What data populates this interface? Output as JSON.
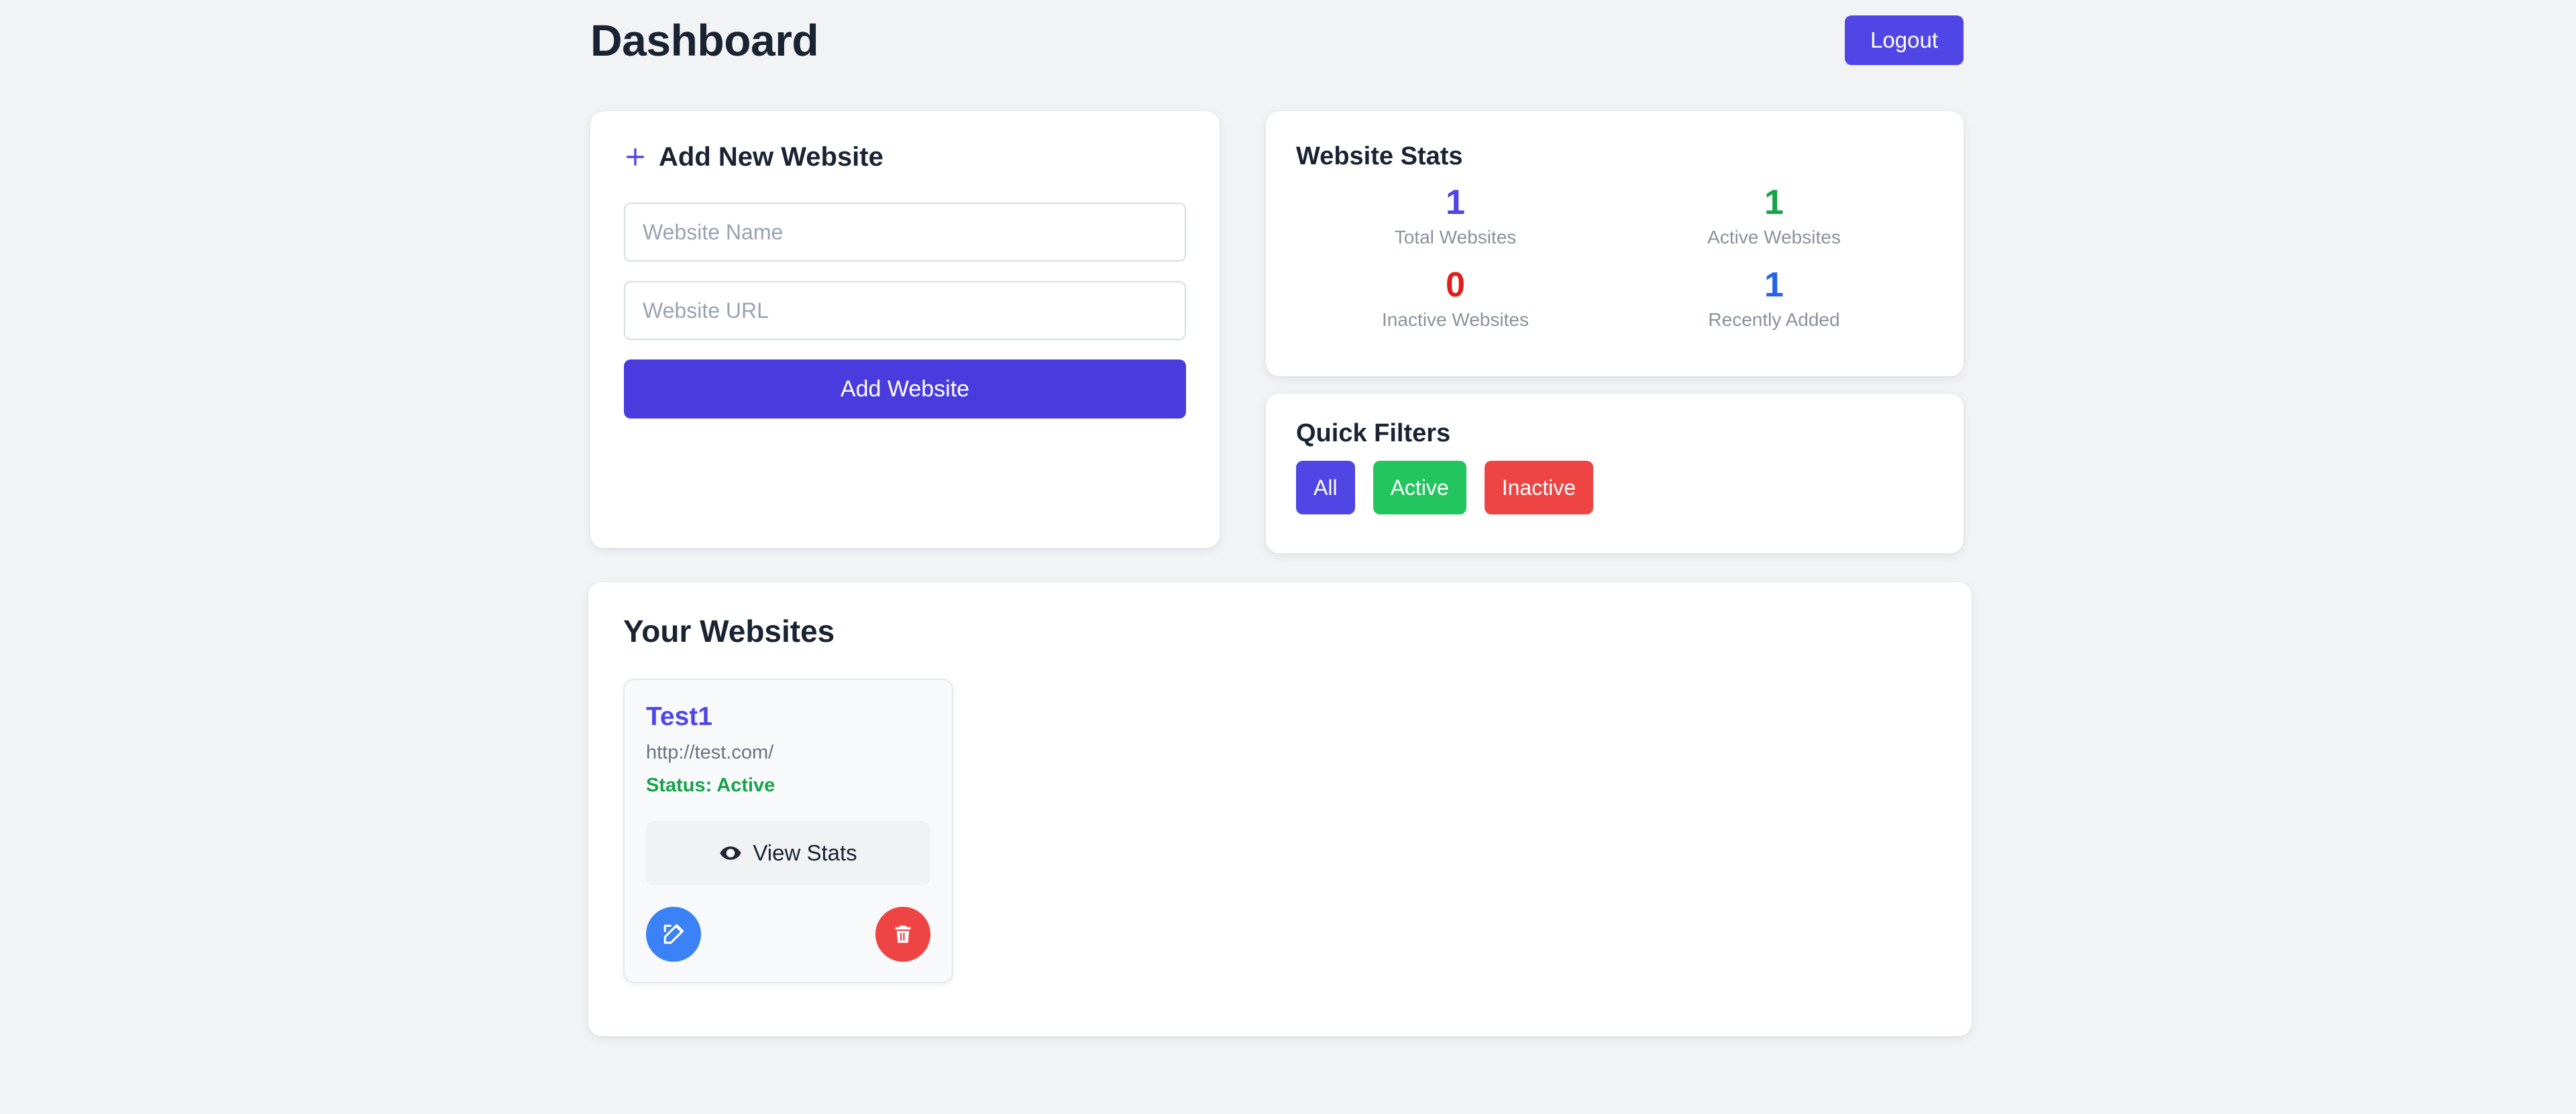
{
  "header": {
    "title": "Dashboard",
    "logout_label": "Logout"
  },
  "add_website": {
    "title": "Add New Website",
    "plus_icon": "plus-icon",
    "name_placeholder": "Website Name",
    "name_value": "",
    "url_placeholder": "Website URL",
    "url_value": "",
    "submit_label": "Add Website",
    "accent_color": "#4a3bdf"
  },
  "stats": {
    "title": "Website Stats",
    "items": [
      {
        "value": "1",
        "label": "Total Websites",
        "color": "#4f46e5"
      },
      {
        "value": "1",
        "label": "Active Websites",
        "color": "#16a34a"
      },
      {
        "value": "0",
        "label": "Inactive Websites",
        "color": "#e11d1d"
      },
      {
        "value": "1",
        "label": "Recently Added",
        "color": "#2563eb"
      }
    ]
  },
  "quick_filters": {
    "title": "Quick Filters",
    "buttons": [
      {
        "label": "All",
        "color": "#4f46e5"
      },
      {
        "label": "Active",
        "color": "#22c55e"
      },
      {
        "label": "Inactive",
        "color": "#ef4444"
      }
    ]
  },
  "websites_section": {
    "title": "Your Websites",
    "items": [
      {
        "name": "Test1",
        "url": "http://test.com/",
        "status": "Status: Active",
        "status_color": "#15a34a",
        "view_stats_label": "View Stats",
        "view_stats_icon": "eye-icon",
        "edit_icon": "edit-icon",
        "delete_icon": "trash-icon"
      }
    ]
  }
}
